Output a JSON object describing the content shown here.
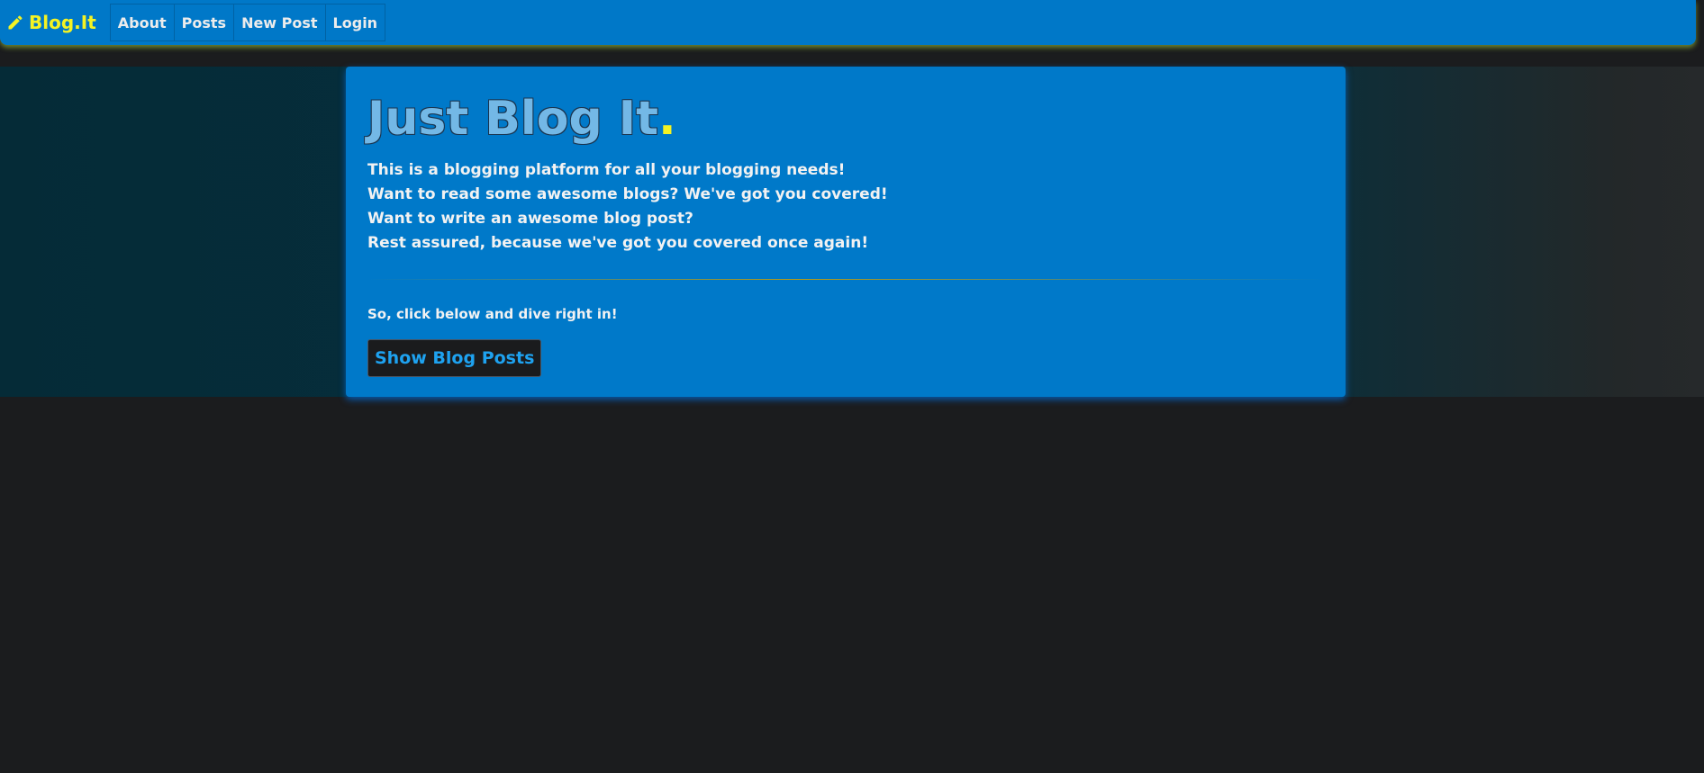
{
  "nav": {
    "brand": "Blog.It",
    "brand_icon": "pencil-icon",
    "items": [
      {
        "label": "About"
      },
      {
        "label": "Posts"
      },
      {
        "label": "New Post"
      },
      {
        "label": "Login"
      }
    ]
  },
  "hero": {
    "title": "Just Blog It",
    "title_dot": ".",
    "lines": [
      "This is a blogging platform for all your blogging needs!",
      "Want to read some awesome blogs? We've got you covered!",
      "Want to write an awesome blog post?",
      "Rest assured, because we've got you covered once again!"
    ],
    "cta_text": "So, click below and dive right in!",
    "cta_button": "Show Blog Posts"
  },
  "colors": {
    "navbar": "#0078c8",
    "brand": "#f4f323",
    "background": "#1b1c1e",
    "jumbotron": "#0079c9",
    "button_text": "#1ea2f0"
  }
}
